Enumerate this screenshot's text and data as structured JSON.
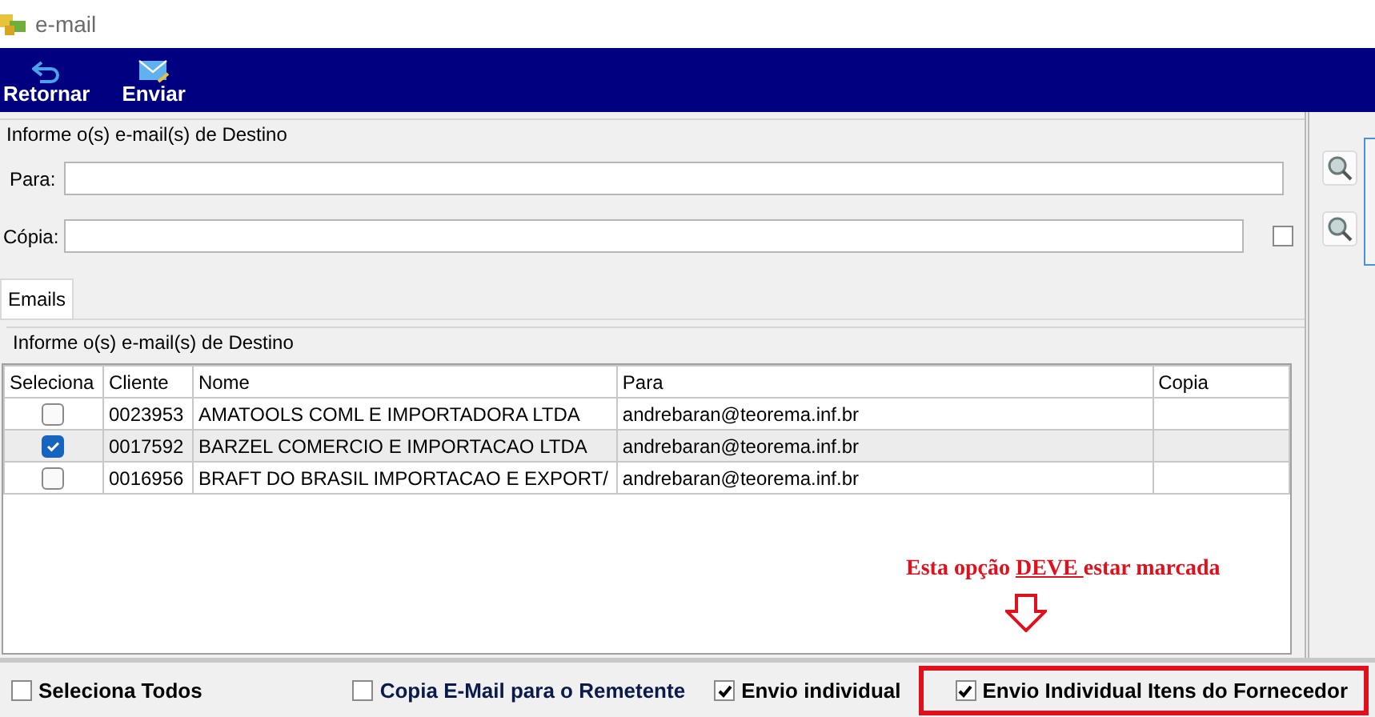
{
  "window": {
    "title": "e-mail"
  },
  "toolbar": [
    {
      "kind": "back",
      "label": "Retornar"
    },
    {
      "kind": "send",
      "label": "Enviar"
    }
  ],
  "destination": {
    "legend": "Informe o(s) e-mail(s) de Destino",
    "to_label": "Para:",
    "cc_label": "Cópia:",
    "cc_checked": false
  },
  "tabs": [
    {
      "label": "Emails",
      "selected": true
    }
  ],
  "recipients": {
    "legend": "Informe o(s) e-mail(s) de Destino",
    "columns": [
      "Seleciona",
      "Cliente",
      "Nome",
      "Para",
      "Copia"
    ],
    "rows": [
      {
        "checked": false,
        "selected": false,
        "cliente": "0023953",
        "nome": "AMATOOLS COML E IMPORTADORA LTDA",
        "para": "andrebaran@teorema.inf.br"
      },
      {
        "checked": true,
        "selected": true,
        "cliente": "0017592",
        "nome": "BARZEL COMERCIO E IMPORTACAO LTDA",
        "para": "andrebaran@teorema.inf.br"
      },
      {
        "checked": false,
        "selected": false,
        "cliente": "0016956",
        "nome": "BRAFT DO BRASIL IMPORTACAO E EXPORT/",
        "para": "andrebaran@teorema.inf.br"
      }
    ]
  },
  "annotation": {
    "before": "Esta opção",
    "emphasis": "DEVE",
    "after": "estar marcada"
  },
  "options": [
    {
      "label": "Seleciona Todos",
      "checked": false,
      "highlighted": false
    },
    {
      "label": "Copia E-Mail para o Remetente",
      "checked": false,
      "highlighted": false
    },
    {
      "label": "Envio individual",
      "checked": true,
      "highlighted": false
    },
    {
      "label": "Envio Individual Itens do Fornecedor",
      "checked": true,
      "highlighted": true
    }
  ]
}
